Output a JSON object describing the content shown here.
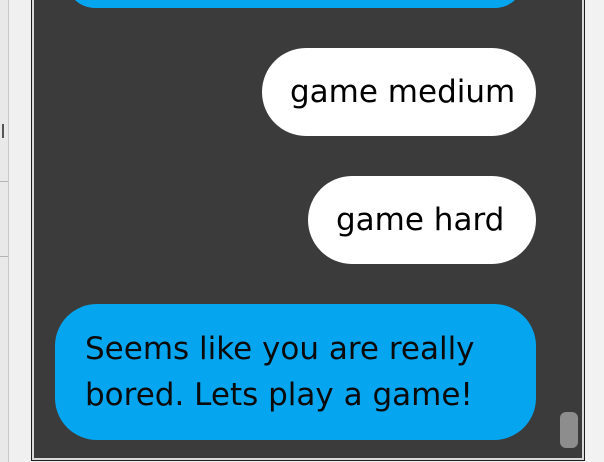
{
  "chat": {
    "messages": [
      {
        "sender": "bot",
        "text": ""
      },
      {
        "sender": "user",
        "text": "game medium"
      },
      {
        "sender": "user",
        "text": "game hard"
      },
      {
        "sender": "bot",
        "text": "Seems like you are really bored. Lets play a game!"
      }
    ]
  },
  "colors": {
    "chat_background": "#3b3b3b",
    "bot_bubble": "#05a6ef",
    "user_bubble": "#ffffff",
    "scrollbar_thumb": "#8d8d8d"
  }
}
